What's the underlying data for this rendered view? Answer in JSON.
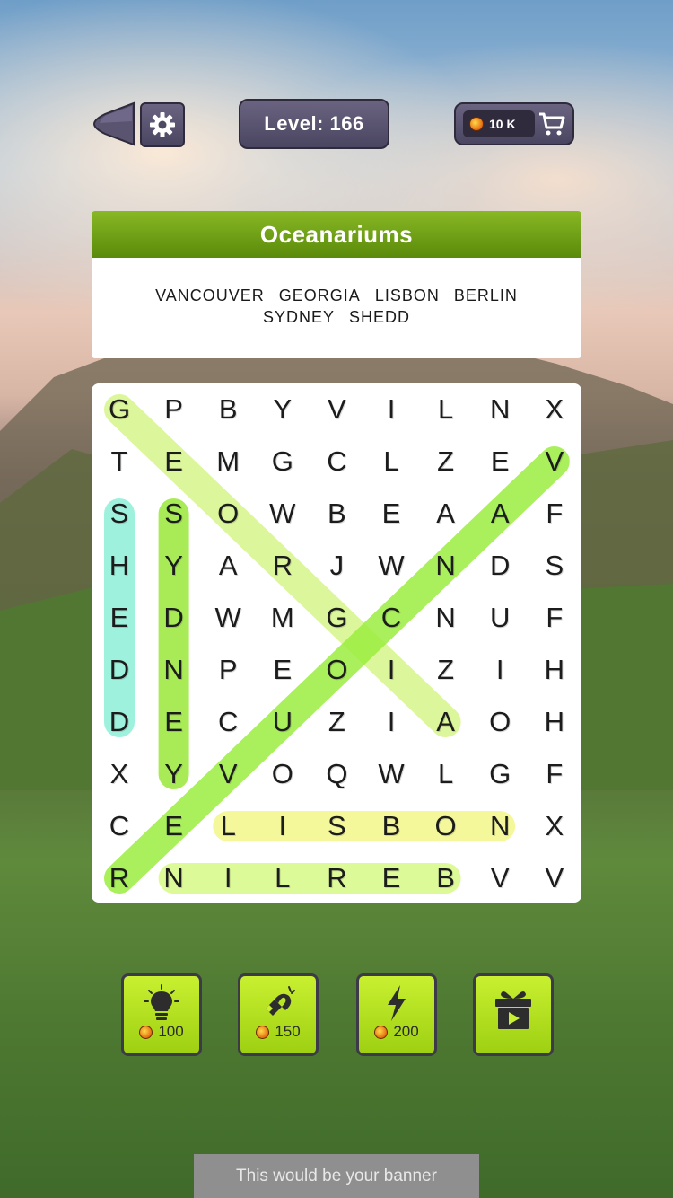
{
  "header": {
    "level_label": "Level: 166",
    "coins": "10 K"
  },
  "category": {
    "title": "Oceanariums",
    "words": [
      "VANCOUVER",
      "GEORGIA",
      "LISBON",
      "BERLIN",
      "SYDNEY",
      "SHEDD"
    ]
  },
  "grid": {
    "rows": [
      [
        "G",
        "P",
        "B",
        "Y",
        "V",
        "I",
        "L",
        "N",
        "X"
      ],
      [
        "T",
        "E",
        "M",
        "G",
        "C",
        "L",
        "Z",
        "E",
        "V"
      ],
      [
        "S",
        "S",
        "O",
        "W",
        "B",
        "E",
        "A",
        "A",
        "F"
      ],
      [
        "H",
        "Y",
        "A",
        "R",
        "J",
        "W",
        "N",
        "D",
        "S"
      ],
      [
        "E",
        "D",
        "W",
        "M",
        "G",
        "C",
        "N",
        "U",
        "F"
      ],
      [
        "D",
        "N",
        "P",
        "E",
        "O",
        "I",
        "Z",
        "I",
        "H"
      ],
      [
        "D",
        "E",
        "C",
        "U",
        "Z",
        "I",
        "A",
        "O",
        "H"
      ],
      [
        "X",
        "Y",
        "V",
        "O",
        "Q",
        "W",
        "L",
        "G",
        "F"
      ],
      [
        "C",
        "E",
        "L",
        "I",
        "S",
        "B",
        "O",
        "N",
        "X"
      ],
      [
        "R",
        "N",
        "I",
        "L",
        "R",
        "E",
        "B",
        "V",
        "V"
      ]
    ],
    "found": [
      {
        "word": "SHEDD",
        "from": [
          2,
          0
        ],
        "to": [
          6,
          0
        ],
        "color": "#8ef0d8"
      },
      {
        "word": "SYDNEY",
        "from": [
          2,
          1
        ],
        "to": [
          7,
          1
        ],
        "color": "#9be83a"
      },
      {
        "word": "GEORGIA",
        "from": [
          0,
          0
        ],
        "to": [
          6,
          6
        ],
        "color": "#d6f58a"
      },
      {
        "word": "VANCOUVER",
        "from": [
          1,
          8
        ],
        "to": [
          9,
          0
        ],
        "color": "#9cee40"
      },
      {
        "word": "LISBON",
        "from": [
          8,
          2
        ],
        "to": [
          8,
          7
        ],
        "color": "#f3f78a"
      },
      {
        "word": "BERLIN",
        "from": [
          9,
          1
        ],
        "to": [
          9,
          6
        ],
        "color": "#d8fa88"
      }
    ]
  },
  "powerups": [
    {
      "name": "hint",
      "icon": "lightbulb-icon",
      "cost": "100"
    },
    {
      "name": "magnet",
      "icon": "magnet-icon",
      "cost": "150"
    },
    {
      "name": "lightning",
      "icon": "lightning-icon",
      "cost": "200"
    },
    {
      "name": "video-gift",
      "icon": "gift-video-icon",
      "cost": ""
    }
  ],
  "banner": {
    "text": "This would be your banner"
  },
  "colors": {
    "category_header": "#6a9a12",
    "panel_dark": "#4f4a64",
    "powerup_green": "#b4e420"
  }
}
